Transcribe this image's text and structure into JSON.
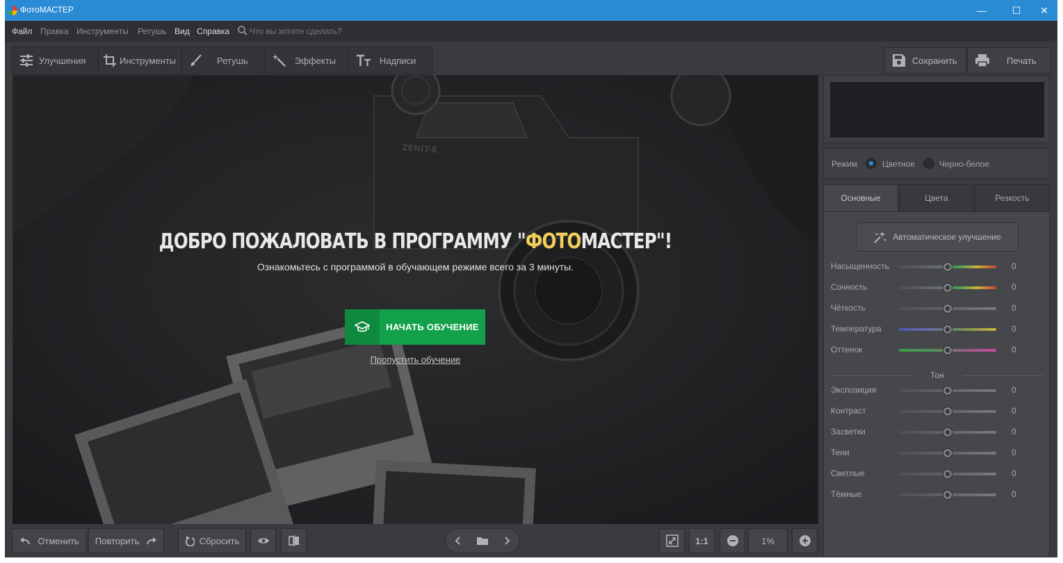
{
  "window": {
    "title": "ФотоМАСТЕР",
    "minimize_glyph": "—",
    "maximize_glyph": "☐",
    "close_glyph": "✕"
  },
  "menu": {
    "items": [
      "Файл",
      "Правка",
      "Инструменты",
      "Ретушь",
      "Вид",
      "Справка"
    ],
    "search_placeholder": "Что вы хотите сделать?"
  },
  "toolbar": {
    "tabs": [
      {
        "label": "Улучшения",
        "icon": "sliders-icon"
      },
      {
        "label": "Инструменты",
        "icon": "crop-icon"
      },
      {
        "label": "Ретушь",
        "icon": "brush-icon"
      },
      {
        "label": "Эффекты",
        "icon": "magic-wand-icon"
      },
      {
        "label": "Надписи",
        "icon": "text-icon"
      }
    ],
    "save_label": "Сохранить",
    "print_label": "Печать"
  },
  "welcome": {
    "title_part1": "ДОБРО ПОЖАЛОВАТЬ В ПРОГРАММУ \"",
    "title_accent": "ФОТО",
    "title_part2": "МАСТЕР\"!",
    "subtitle": "Ознакомьтесь с программой в обучающем режиме всего за 3 минуты.",
    "start_button": "НАЧАТЬ ОБУЧЕНИЕ",
    "skip_link": "Пропустить обучение",
    "accent_color": "#f2cf5a",
    "button_color": "#12a14a"
  },
  "bottombar": {
    "undo_label": "Отменить",
    "redo_label": "Повторить",
    "reset_label": "Сбросить",
    "zoom_1to1": "1:1",
    "zoom_value": "1%"
  },
  "panel": {
    "mode_label": "Режим",
    "mode_color": "Цветное",
    "mode_bw": "Черно-белое",
    "mode_selected": "Цветное",
    "tabs": [
      "Основные",
      "Цвета",
      "Резкость"
    ],
    "active_tab": "Основные",
    "auto_button": "Автоматическое улучшение",
    "sliders": [
      {
        "label": "Насыщенность",
        "value": "0",
        "level": 0.5
      },
      {
        "label": "Сочность",
        "value": "0",
        "level": 0.5
      },
      {
        "label": "Чёткость",
        "value": "0",
        "level": 0.5
      },
      {
        "label": "Температура",
        "value": "0",
        "level": 0.5
      },
      {
        "label": "Оттенок",
        "value": "0",
        "level": 0.5
      }
    ],
    "tone_header": "Тон",
    "tone_sliders": [
      {
        "label": "Экспозиция",
        "value": "0",
        "level": 0.5
      },
      {
        "label": "Контраст",
        "value": "0",
        "level": 0.5
      },
      {
        "label": "Засветки",
        "value": "0",
        "level": 0.5
      },
      {
        "label": "Тени",
        "value": "0",
        "level": 0.5
      },
      {
        "label": "Светлые",
        "value": "0",
        "level": 0.5
      },
      {
        "label": "Тёмные",
        "value": "0",
        "level": 0.5
      }
    ]
  },
  "colors": {
    "titlebar": "#2b8ad4",
    "radio_selected": "#2d8ee0"
  }
}
